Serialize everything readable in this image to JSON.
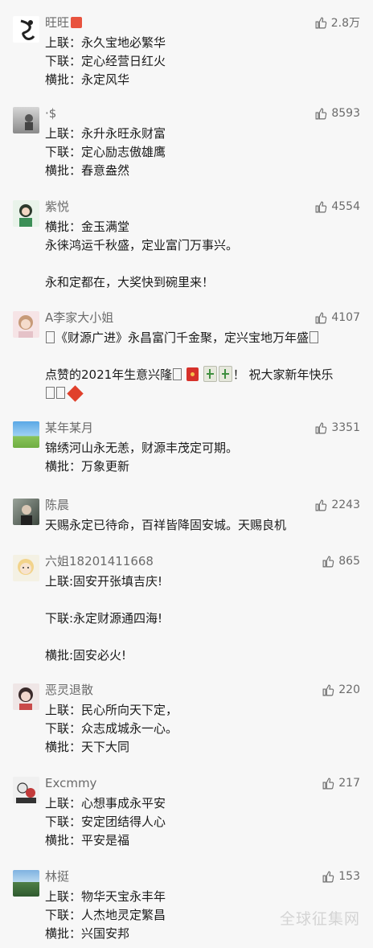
{
  "comments": [
    {
      "name": "旺旺",
      "likes": "2.8万",
      "lines": [
        "上联：永久宝地必繁华",
        "下联：定心经营日红火",
        "横批：永定风华"
      ]
    },
    {
      "name": "·$",
      "likes": "8593",
      "lines": [
        "上联：永升永旺永财富",
        "下联：定心励志傲雄鹰",
        "横批：春意盎然"
      ]
    },
    {
      "name": "紫悦",
      "likes": "4554",
      "lines": [
        "横批：金玉满堂",
        "永徕鸿运千秋盛，定业富门万事兴。",
        "",
        "永和定都在，大奖快到碗里来！"
      ]
    },
    {
      "name": "A李家大小姐",
      "likes": "4107",
      "lines": [
        "《财源广进》永昌富门千金聚，定兴宝地万年盛",
        "",
        "点赞的2021年生意兴隆",
        "！ 祝大家新年快乐"
      ]
    },
    {
      "name": "某年某月",
      "likes": "3351",
      "lines": [
        "锦绣河山永无恙，财源丰茂定可期。",
        "横批：万象更新"
      ]
    },
    {
      "name": "陈晨",
      "likes": "2243",
      "lines": [
        "天赐永定已待命，百祥皆降固安城。天赐良机"
      ]
    },
    {
      "name": "六姐18201411668",
      "likes": "865",
      "lines": [
        "上联:固安开张填吉庆!",
        "",
        "下联:永定财源通四海!",
        "",
        "横批:固安必火!"
      ]
    },
    {
      "name": "恶灵退散",
      "likes": "220",
      "lines": [
        "上联：民心所向天下定，",
        "下联：众志成城永一心。",
        "横批：天下大同"
      ]
    },
    {
      "name": "Excmmy",
      "likes": "217",
      "lines": [
        "上联：心想事成永平安",
        "下联：安定团结得人心",
        "横批：平安是福"
      ]
    },
    {
      "name": "林挺",
      "likes": "153",
      "lines": [
        "上联：物华天宝永丰年",
        "下联：人杰地灵定繁昌",
        "横批：兴国安邦"
      ]
    }
  ],
  "watermark": "全球征集网",
  "colors": {
    "background": "#f7f7f7",
    "name": "#6b6b6b",
    "text": "#1a1a1a"
  },
  "icons": {
    "like": "thumbs-up-icon"
  }
}
